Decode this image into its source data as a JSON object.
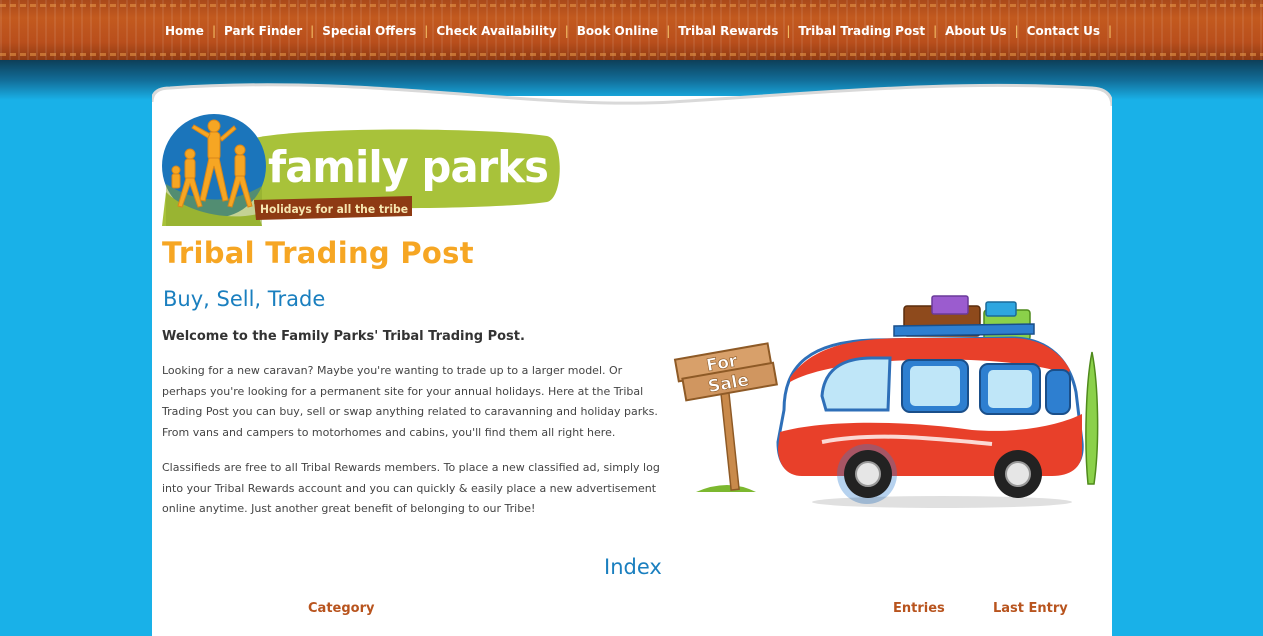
{
  "nav": {
    "items": [
      "Home",
      "Park Finder",
      "Special Offers",
      "Check Availability",
      "Book Online",
      "Tribal Rewards",
      "Tribal Trading Post",
      "About Us",
      "Contact Us"
    ],
    "separator": "|"
  },
  "logo": {
    "name": "family parks",
    "tagline": "Holidays for all the tribe"
  },
  "page": {
    "title": "Tribal Trading Post",
    "subtitle": "Buy, Sell, Trade",
    "welcome": "Welcome to the Family Parks' Tribal Trading Post.",
    "para1": "Looking for a new caravan? Maybe you're wanting to trade up to a larger model. Or perhaps you're looking for a permanent site for your annual holidays. Here at the Tribal Trading Post you can buy, sell or swap anything related to caravanning and holiday parks. From vans and campers to motorhomes and cabins, you'll find them all right here.",
    "para2": "Classifieds are free to all Tribal Rewards members. To place a new classified ad, simply log into your Tribal Rewards account and you can quickly & easily place a new advertisement online anytime. Just another great benefit of belonging to our Tribe!"
  },
  "illustration": {
    "sign_line1": "For",
    "sign_line2": "Sale"
  },
  "index": {
    "title": "Index",
    "columns": [
      "Category",
      "Entries",
      "Last Entry"
    ]
  },
  "colors": {
    "background": "#19b1e8",
    "nav_band": "#c35a1f",
    "title_orange": "#f6a623",
    "heading_blue": "#1a7fbf",
    "logo_green": "#a8c23a"
  }
}
